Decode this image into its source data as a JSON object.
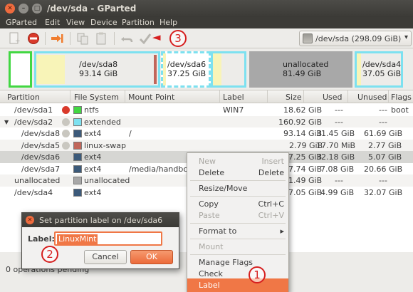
{
  "window": {
    "title": "/dev/sda - GParted"
  },
  "menu": [
    "GParted",
    "Edit",
    "View",
    "Device",
    "Partition",
    "Help"
  ],
  "device_select": {
    "value": "/dev/sda  (298.09 GiB)"
  },
  "annotations": {
    "one": "1",
    "two": "2",
    "three": "3"
  },
  "diskmap": {
    "sda8": {
      "name": "/dev/sda8",
      "size": "93.14 GiB"
    },
    "sda6": {
      "name": "/dev/sda6",
      "size": "37.25 GiB"
    },
    "unalloc": {
      "name": "unallocated",
      "size": "81.49 GiB"
    },
    "sda4": {
      "name": "/dev/sda4",
      "size": "37.05 GiB"
    }
  },
  "columns": [
    "Partition",
    "File System",
    "Mount Point",
    "Label",
    "Size",
    "Used",
    "Unused",
    "Flags"
  ],
  "rows": [
    {
      "partition": "/dev/sda1",
      "fs": "ntfs",
      "mount": "",
      "label": "WIN7",
      "size": "18.62 GiB",
      "used": "---",
      "unused": "---",
      "flags": "boot",
      "color": "#42d742"
    },
    {
      "partition": "/dev/sda2",
      "fs": "extended",
      "mount": "",
      "label": "",
      "size": "160.92 GiB",
      "used": "---",
      "unused": "---",
      "flags": "",
      "color": "#7de1f0"
    },
    {
      "partition": "/dev/sda8",
      "fs": "ext4",
      "mount": "/",
      "label": "",
      "size": "93.14 GiB",
      "used": "31.45 GiB",
      "unused": "61.69 GiB",
      "flags": "",
      "color": "#3c5a7a"
    },
    {
      "partition": "/dev/sda5",
      "fs": "linux-swap",
      "mount": "",
      "label": "",
      "size": "2.79 GiB",
      "used": "17.70 MiB",
      "unused": "2.77 GiB",
      "flags": "",
      "color": "#c1665a"
    },
    {
      "partition": "/dev/sda6",
      "fs": "ext4",
      "mount": "",
      "label": "",
      "size": "37.25 GiB",
      "used": "32.18 GiB",
      "unused": "5.07 GiB",
      "flags": "",
      "color": "#3c5a7a"
    },
    {
      "partition": "/dev/sda7",
      "fs": "ext4",
      "mount": "/media/handboo",
      "label": "",
      "size": "27.74 GiB",
      "used": "7.08 GiB",
      "unused": "20.66 GiB",
      "flags": "",
      "color": "#3c5a7a"
    },
    {
      "partition": "unallocated",
      "fs": "unallocated",
      "mount": "",
      "label": "",
      "size": "81.49 GiB",
      "used": "---",
      "unused": "---",
      "flags": "",
      "color": "#a8a8a8"
    },
    {
      "partition": "/dev/sda4",
      "fs": "ext4",
      "mount": "",
      "label": "",
      "size": "37.05 GiB",
      "used": "4.99 GiB",
      "unused": "32.07 GiB",
      "flags": "",
      "color": "#3c5a7a"
    }
  ],
  "status": "0 operations pending",
  "context_menu": {
    "new": "New",
    "new_sc": "Insert",
    "delete": "Delete",
    "delete_sc": "Delete",
    "resize": "Resize/Move",
    "copy": "Copy",
    "copy_sc": "Ctrl+C",
    "paste": "Paste",
    "paste_sc": "Ctrl+V",
    "format": "Format to",
    "mount": "Mount",
    "flags": "Manage Flags",
    "check": "Check",
    "label": "Label"
  },
  "dialog": {
    "title": "Set partition label on /dev/sda6",
    "label": "Label:",
    "value": "LinuxMint",
    "cancel": "Cancel",
    "ok": "OK"
  }
}
